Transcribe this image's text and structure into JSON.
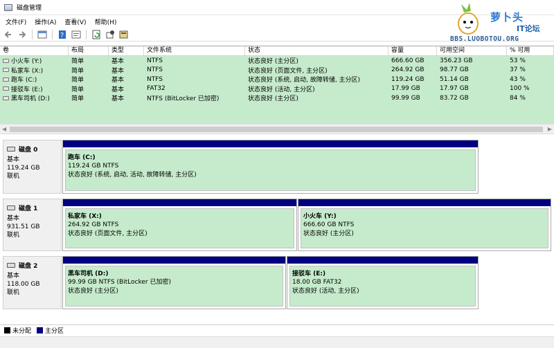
{
  "window": {
    "title": "磁盘管理"
  },
  "menu": [
    "文件(F)",
    "操作(A)",
    "查看(V)",
    "帮助(H)"
  ],
  "toolbar": [
    "back-icon",
    "forward-icon",
    "view-icon",
    "help-icon",
    "properties-icon",
    "refresh-icon",
    "settings-icon",
    "export-icon"
  ],
  "watermark": {
    "brand": "萝卜头",
    "brand2": "IT论坛",
    "url": "BBS.LUOBOTOU.ORG"
  },
  "volume_columns": [
    "卷",
    "布局",
    "类型",
    "文件系统",
    "状态",
    "容量",
    "可用空间",
    "% 可用"
  ],
  "volumes": [
    [
      "小火车 (Y:)",
      "简单",
      "基本",
      "NTFS",
      "状态良好 (主分区)",
      "666.60 GB",
      "356.23 GB",
      "53 %"
    ],
    [
      "私家车 (X:)",
      "简单",
      "基本",
      "NTFS",
      "状态良好 (页面文件, 主分区)",
      "264.92 GB",
      "98.77 GB",
      "37 %"
    ],
    [
      "跑车 (C:)",
      "简单",
      "基本",
      "NTFS",
      "状态良好 (系统, 启动, 故障转储, 主分区)",
      "119.24 GB",
      "51.14 GB",
      "43 %"
    ],
    [
      "接驳车 (E:)",
      "简单",
      "基本",
      "FAT32",
      "状态良好 (活动, 主分区)",
      "17.99 GB",
      "17.97 GB",
      "100 %"
    ],
    [
      "黑车司机 (D:)",
      "简单",
      "基本",
      "NTFS (BitLocker 已加密)",
      "状态良好 (主分区)",
      "99.99 GB",
      "83.72 GB",
      "84 %"
    ]
  ],
  "disks": [
    {
      "name": "磁盘 0",
      "type": "基本",
      "size": "119.24 GB",
      "state": "联机",
      "partitions": [
        {
          "name": "跑车  (C:)",
          "size": "119.24 GB NTFS",
          "status": "状态良好 (系统, 启动, 活动, 故障转储, 主分区)"
        }
      ]
    },
    {
      "name": "磁盘 1",
      "type": "基本",
      "size": "931.51 GB",
      "state": "联机",
      "partitions": [
        {
          "name": "私家车  (X:)",
          "size": "264.92 GB NTFS",
          "status": "状态良好 (页面文件, 主分区)"
        },
        {
          "name": "小火车  (Y:)",
          "size": "666.60 GB NTFS",
          "status": "状态良好 (主分区)"
        }
      ]
    },
    {
      "name": "磁盘 2",
      "type": "基本",
      "size": "118.00 GB",
      "state": "联机",
      "partitions": [
        {
          "name": "黑车司机  (D:)",
          "size": "99.99 GB NTFS (BitLocker 已加密)",
          "status": "状态良好 (主分区)"
        },
        {
          "name": "接驳车  (E:)",
          "size": "18.00 GB FAT32",
          "status": "状态良好 (活动, 主分区)"
        }
      ]
    }
  ],
  "legend": [
    {
      "label": "未分配",
      "color": "#000000"
    },
    {
      "label": "主分区",
      "color": "#000080"
    }
  ]
}
